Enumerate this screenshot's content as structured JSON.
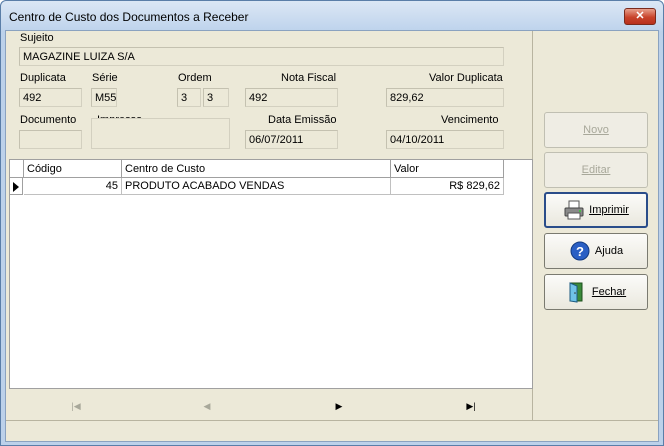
{
  "window": {
    "title": "Centro de Custo dos Documentos a Receber",
    "close_glyph": "✕"
  },
  "form": {
    "sujeito": {
      "label": "Sujeito",
      "value": "MAGAZINE LUIZA S/A"
    },
    "duplicata": {
      "label": "Duplicata",
      "value": "492"
    },
    "serie": {
      "label": "Série",
      "value": "M55"
    },
    "ordem": {
      "label": "Ordem",
      "value1": "3",
      "value2": "3"
    },
    "nota_fiscal": {
      "label": "Nota Fiscal",
      "value": "492"
    },
    "valor_duplicata": {
      "label": "Valor Duplicata",
      "value": "829,62"
    },
    "documento": {
      "label": "Documento",
      "value": ""
    },
    "impressa": {
      "label": "Impressa",
      "value": ""
    },
    "data_emissao": {
      "label": "Data Emissão",
      "value": "06/07/2011"
    },
    "vencimento": {
      "label": "Vencimento",
      "value": "04/10/2011"
    }
  },
  "grid": {
    "columns": [
      "Código",
      "Centro de Custo",
      "Valor"
    ],
    "rows": [
      {
        "codigo": "45",
        "centro": "PRODUTO ACABADO VENDAS",
        "valor": "R$ 829,62"
      }
    ]
  },
  "navigator": {
    "first": "|◀",
    "prior": "◀",
    "next": "▶",
    "last": "▶|"
  },
  "buttons": {
    "novo": {
      "label": "Novo",
      "enabled": false
    },
    "editar": {
      "label": "Editar",
      "enabled": false
    },
    "imprimir": {
      "label": "Imprimir",
      "enabled": true,
      "icon": "printer-icon"
    },
    "ajuda": {
      "label": "Ajuda",
      "enabled": true,
      "icon": "help-icon"
    },
    "fechar": {
      "label": "Fechar",
      "enabled": true,
      "icon": "exit-door-icon"
    }
  },
  "colors": {
    "window_frame": "#bcd1ea",
    "client_bg": "#ece9d8",
    "close_button": "#c8432b",
    "disabled_text": "#a8a89a"
  }
}
